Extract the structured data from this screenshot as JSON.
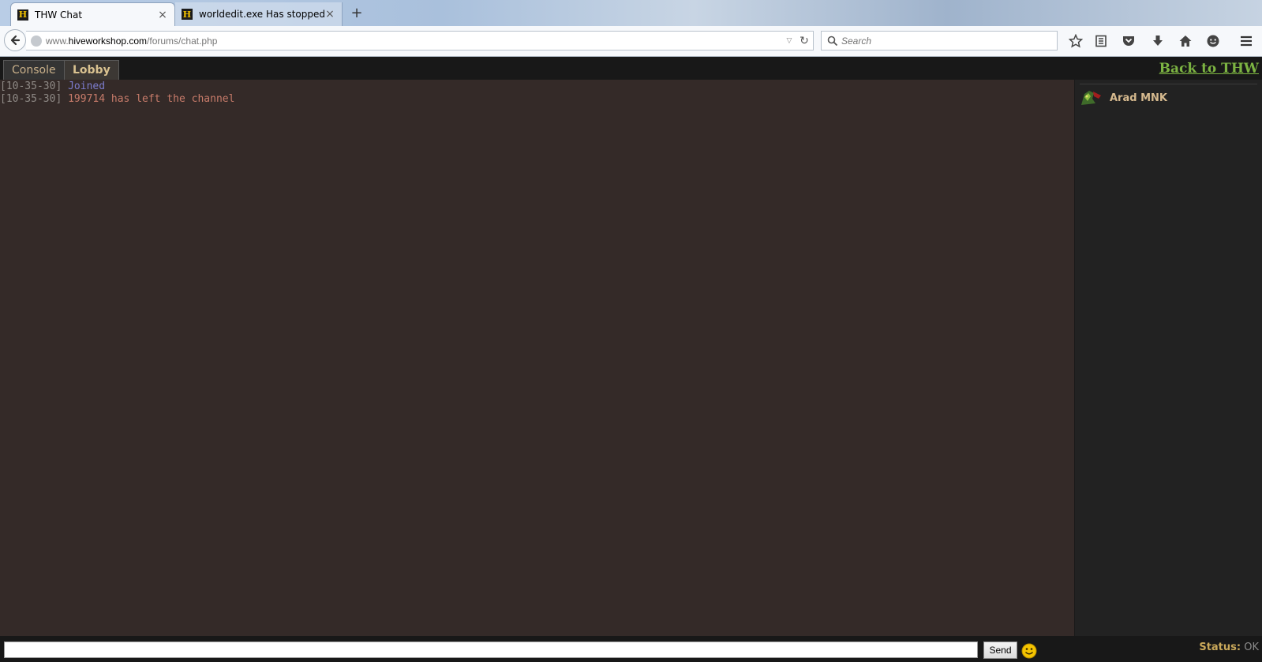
{
  "browser": {
    "tabs": [
      {
        "favicon": "H",
        "title": "THW Chat",
        "active": true
      },
      {
        "favicon": "H",
        "title": "worldedit.exe Has stopped ...",
        "active": false
      }
    ],
    "new_tab_label": "+",
    "url": {
      "prefix": "www.",
      "host": "hiveworkshop.com",
      "path": "/forums/chat.php"
    },
    "search_placeholder": "Search",
    "toolbar_icons": [
      "star-icon",
      "reading-list-icon",
      "pocket-icon",
      "download-icon",
      "home-icon",
      "chat-icon",
      "menu-icon"
    ]
  },
  "chat": {
    "tabs": [
      {
        "label": "Console",
        "selected": false
      },
      {
        "label": "Lobby",
        "selected": true
      }
    ],
    "back_link": "Back to THW",
    "messages": [
      {
        "time": "[10-35-30]",
        "text": "Joined",
        "kind": "joined"
      },
      {
        "time": "[10-35-30]",
        "text": "199714 has left the channel",
        "kind": "left"
      }
    ],
    "users": [
      {
        "name": "Arad MNK",
        "avatar": "avatar-icon"
      }
    ],
    "input_value": "",
    "send_label": "Send",
    "status_label": "Status:",
    "status_value": "OK",
    "colors": {
      "background": "#342a28",
      "sidebar": "#222222",
      "joined": "#7c7ccd",
      "left": "#c77b6a",
      "back_link": "#7cb342",
      "username": "#d5b98e"
    }
  }
}
